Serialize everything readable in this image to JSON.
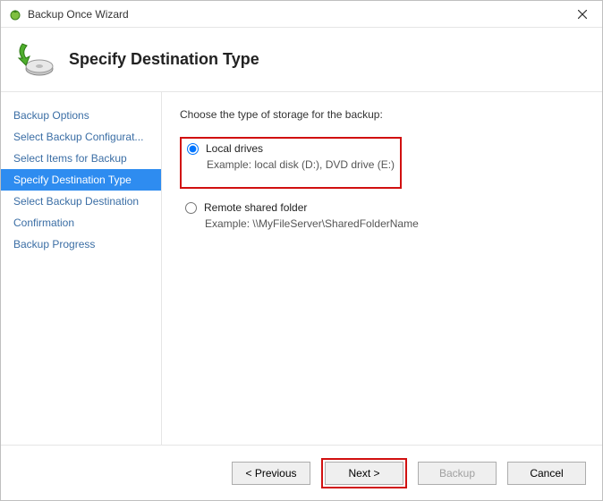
{
  "window": {
    "title": "Backup Once Wizard"
  },
  "header": {
    "title": "Specify Destination Type"
  },
  "sidebar": {
    "items": [
      {
        "label": "Backup Options",
        "selected": false
      },
      {
        "label": "Select Backup Configurat...",
        "selected": false
      },
      {
        "label": "Select Items for Backup",
        "selected": false
      },
      {
        "label": "Specify Destination Type",
        "selected": true
      },
      {
        "label": "Select Backup Destination",
        "selected": false
      },
      {
        "label": "Confirmation",
        "selected": false
      },
      {
        "label": "Backup Progress",
        "selected": false
      }
    ]
  },
  "content": {
    "prompt": "Choose the type of storage for the backup:",
    "options": [
      {
        "id": "local",
        "label": "Local drives",
        "example": "Example: local disk (D:), DVD drive (E:)",
        "checked": true,
        "highlighted": true
      },
      {
        "id": "remote",
        "label": "Remote shared folder",
        "example": "Example: \\\\MyFileServer\\SharedFolderName",
        "checked": false,
        "highlighted": false
      }
    ]
  },
  "footer": {
    "previous": "< Previous",
    "next": "Next >",
    "backup": "Backup",
    "cancel": "Cancel"
  }
}
